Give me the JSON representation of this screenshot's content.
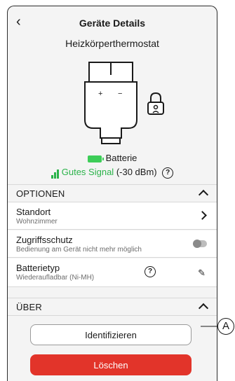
{
  "header": {
    "back_icon": "chevron-left-icon",
    "title": "Geräte Details",
    "subtitle": "Heizkörperthermostat"
  },
  "device": {
    "plus": "+",
    "minus": "−",
    "lock_icon": "child-lock-icon"
  },
  "status": {
    "battery_label": "Batterie",
    "battery_level": 1.0,
    "signal_label": "Gutes Signal",
    "signal_value": "(-30 dBm)",
    "help_mark": "?"
  },
  "options": {
    "label": "OPTIONEN",
    "rows": [
      {
        "title": "Standort",
        "sub": "Wohnzimmer"
      },
      {
        "title": "Zugriffsschutz",
        "sub": "Bedienung am Gerät nicht mehr möglich",
        "toggle_on": false
      },
      {
        "title": "Batterietyp",
        "sub": "Wiederaufladbar (Ni-MH)",
        "help_mark": "?"
      }
    ]
  },
  "about": {
    "label": "ÜBER"
  },
  "buttons": {
    "identify": "Identifizieren",
    "delete": "Löschen"
  },
  "annotation": {
    "marker": "A"
  },
  "colors": {
    "accent_green": "#3dcd58",
    "signal_green": "#2bb34a",
    "danger_red": "#e2342a",
    "background": "#f4f4f4"
  }
}
